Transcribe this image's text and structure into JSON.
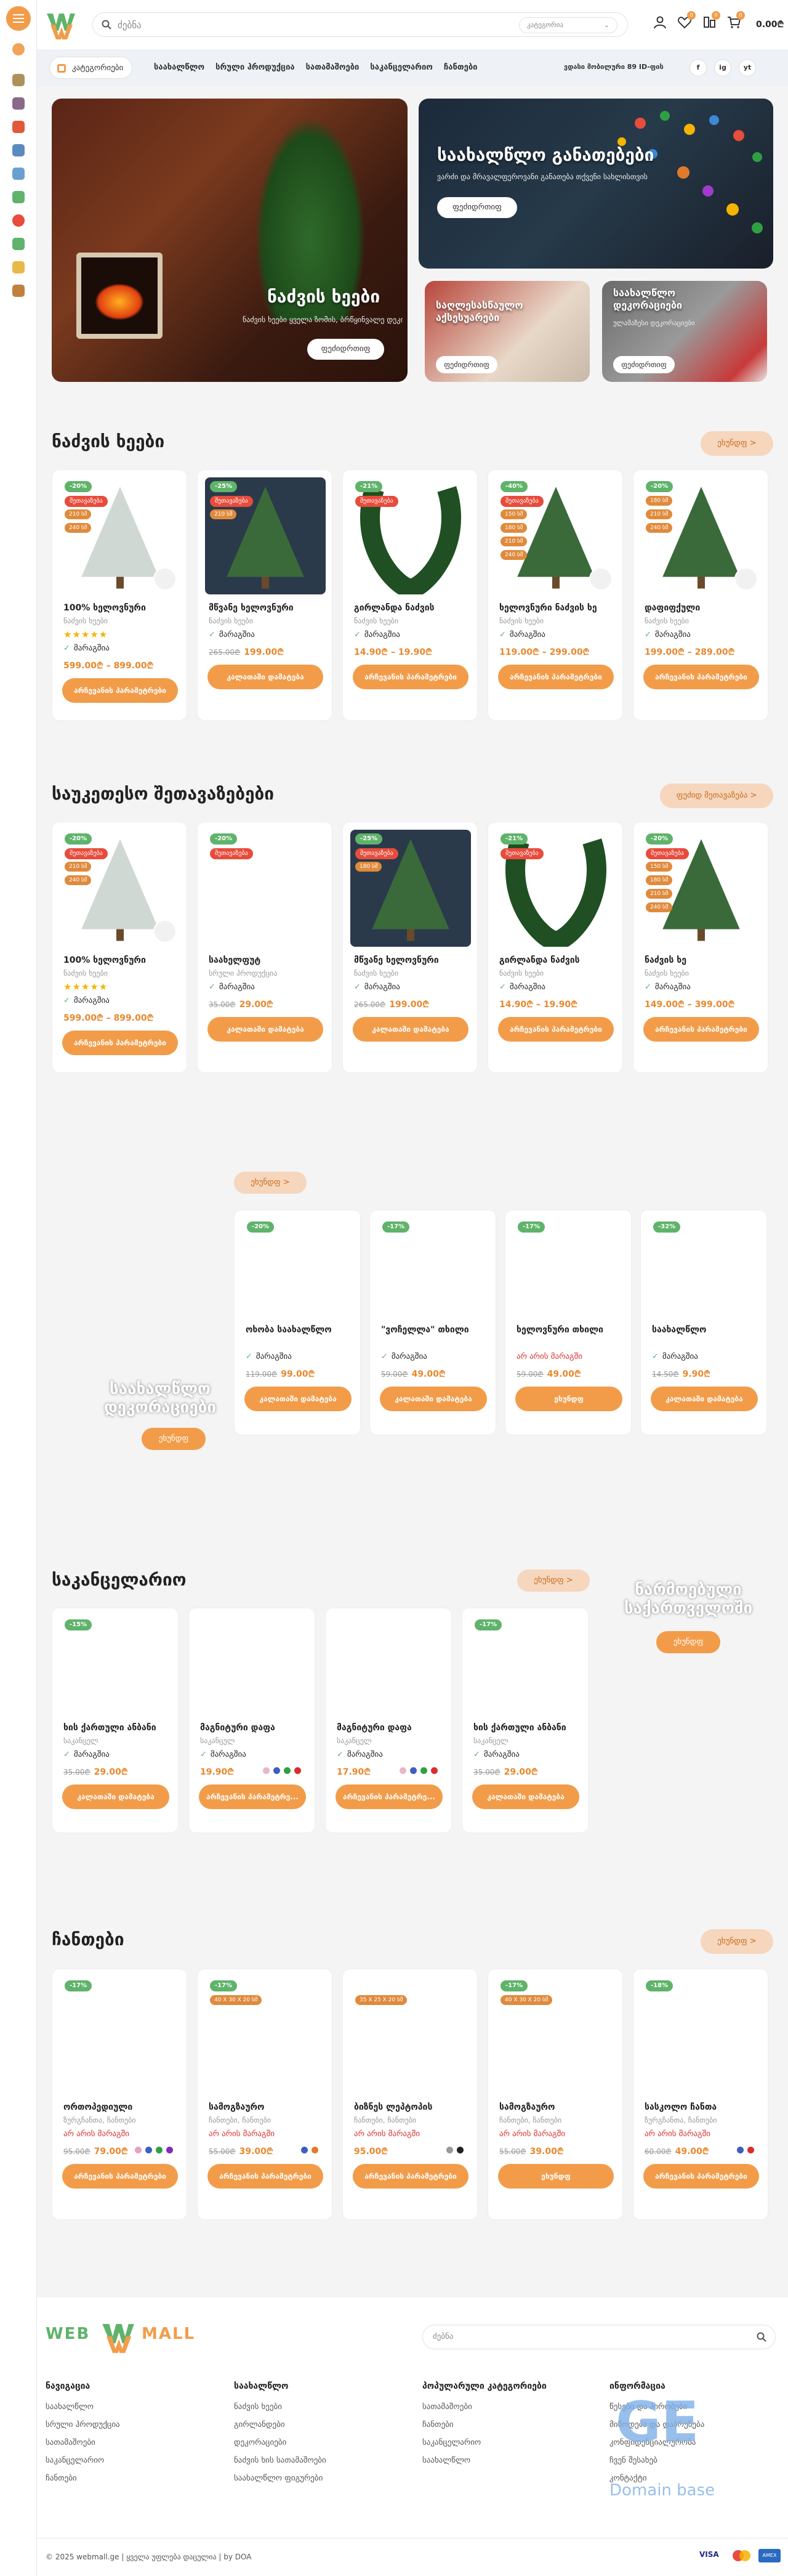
{
  "header": {
    "search_placeholder": "ძებნა",
    "category_select": "კატეგორია",
    "cart_total": "0.00₾",
    "wishlist_count": "0",
    "compare_count": "0",
    "cart_count": "0"
  },
  "nav": {
    "categories_button": "კატეგორიები",
    "links": [
      "საახალწლო",
      "სრული ჰროდუქცია",
      "სათამაშოები",
      "საკანცელარიო",
      "ჩანთები"
    ],
    "phone": "ვდასი მობილური 89 ID-ფის"
  },
  "social": [
    "f",
    "ig",
    "yt"
  ],
  "hero": {
    "main": {
      "title": "ნაძვის ხეები",
      "subtitle": "ნაძვის ხეები ყველა ზომის, ბრწყინვალე დეკორი",
      "button": "ფეძიდრთიფ"
    },
    "top_right": {
      "title": "საახალწლო განათებები",
      "subtitle": "ვარძი და მრავალფეროვანი განათება თქვენი სახლისთვის",
      "button": "ფეძიდრთიფ"
    },
    "bottom_left": {
      "title": "საღლესასწაულო აქსესუარები",
      "button": "ფეძიდრთიფ"
    },
    "bottom_right": {
      "title": "საახალწლო დეკორაციები",
      "subtitle": "ულამაზესი დეკორაციები",
      "button": "ფეძიდრთიფ"
    }
  },
  "sections": {
    "trees": {
      "title": "ნაძვის ხეები",
      "button": "ეხუნდფ >"
    },
    "best": {
      "title": "საუკეთესო შეთავაზებები",
      "button": "ფეძიდ მეთავაზება >"
    },
    "holiday": {
      "button": "ეხუნდფ >",
      "side_title": "საახალწლო დეკორაციები",
      "side_button": "ეხუნდფ"
    },
    "stationery": {
      "title": "საკანცელარიო",
      "button": "ეხუნდფ >",
      "side_title": "ნარმოებული საქართველოში",
      "side_button": "ეხუნდფ"
    },
    "bags": {
      "title": "ჩანთები",
      "button": "ეხუნდფ >"
    }
  },
  "trees_products": [
    {
      "discount": "-20%",
      "tags": [
        "შეთავაზება",
        "210 სმ",
        "240 სმ"
      ],
      "name": "100% ხელოვნური",
      "cat": "ნაძვის ხეები",
      "stock": "მარაგშია",
      "stars": "★★★★★",
      "price": "599.00₾ – 899.00₾",
      "old": "",
      "cta": "არჩევანის პარამეტრები"
    },
    {
      "discount": "-25%",
      "tags": [
        "შეთავაზება",
        "210 სმ"
      ],
      "name": "მწვანე ხელოვნური",
      "cat": "ნაძვის ხეები",
      "stock": "მარაგშია",
      "stars": "",
      "price": "199.00₾",
      "old": "265.00₾",
      "cta": "კალათაში დამატება"
    },
    {
      "discount": "-21%",
      "tags": [
        "შეთავაზება"
      ],
      "name": "გირლანდა ნაძვის",
      "cat": "ნაძვის ხეები",
      "stock": "მარაგშია",
      "stars": "",
      "price": "14.90₾ – 19.90₾",
      "old": "",
      "cta": "არჩევანის პარამეტრები"
    },
    {
      "discount": "-40%",
      "tags": [
        "შეთავაზება",
        "150 სმ",
        "180 სმ",
        "210 სმ",
        "240 სმ"
      ],
      "name": "ხელოვნური ნაძვის ხე",
      "cat": "ნაძვის ხეები",
      "stock": "მარაგშია",
      "stars": "",
      "price": "119.00₾ – 299.00₾",
      "old": "",
      "cta": "არჩევანის პარამეტრები"
    },
    {
      "discount": "-20%",
      "tags": [
        "180 სმ",
        "210 სმ",
        "240 სმ"
      ],
      "name": "დაფიფქული",
      "cat": "ნაძვის ხეები",
      "stock": "მარაგშია",
      "stars": "",
      "price": "199.00₾ – 289.00₾",
      "old": "",
      "cta": "არჩევანის პარამეტრები"
    }
  ],
  "best_products": [
    {
      "discount": "-20%",
      "tags": [
        "შეთავაზება",
        "210 სმ",
        "240 სმ"
      ],
      "name": "100% ხელოვნური",
      "cat": "ნაძვის ხეები",
      "stock": "მარაგშია",
      "stars": "★★★★★",
      "price": "599.00₾ – 899.00₾",
      "old": "",
      "cta": "არჩევანის პარამეტრები"
    },
    {
      "discount": "-20%",
      "tags": [
        "შეთავაზება"
      ],
      "name": "საახელფუტ",
      "cat": "სრული ჰროდუქცია",
      "stock": "მარაგშია",
      "stars": "",
      "price": "29.00₾",
      "old": "35.00₾",
      "cta": "კალათაში დამატება"
    },
    {
      "discount": "-25%",
      "tags": [
        "შეთავაზება",
        "180 სმ"
      ],
      "name": "მწვანე ხელოვნური",
      "cat": "ნაძვის ხეები",
      "stock": "მარაგშია",
      "stars": "",
      "price": "199.00₾",
      "old": "265.00₾",
      "cta": "კალათაში დამატება"
    },
    {
      "discount": "-21%",
      "tags": [
        "შეთავაზება"
      ],
      "name": "გირლანდა ნაძვის",
      "cat": "ნაძვის ხეები",
      "stock": "მარაგშია",
      "stars": "",
      "price": "14.90₾ – 19.90₾",
      "old": "",
      "cta": "არჩევანის პარამეტრები"
    },
    {
      "discount": "-20%",
      "tags": [
        "შეთავაზება",
        "150 სმ",
        "180 სმ",
        "210 სმ",
        "240 სმ"
      ],
      "name": "ნაძვის ხე",
      "cat": "ნაძვის ხეები",
      "stock": "მარაგშია",
      "stars": "",
      "price": "149.00₾ – 399.00₾",
      "old": "",
      "cta": "არჩევანის პარამეტრები"
    }
  ],
  "holiday_products": [
    {
      "discount": "-20%",
      "name": "ოხობა საახალწლო",
      "cat": "",
      "stock": "მარაგშია",
      "price": "99.00₾",
      "old": "119.00₾",
      "cta": "კალათაში დამატება",
      "red": false
    },
    {
      "discount": "-17%",
      "name": "\"ვოჩელლა\" თხილი",
      "cat": "",
      "stock": "მარაგშია",
      "price": "49.00₾",
      "old": "59.00₾",
      "cta": "კალათაში დამატება",
      "red": false
    },
    {
      "discount": "-17%",
      "name": "ხელოვნური თხილი",
      "cat": "",
      "stock": "არ არის მარაგში",
      "price": "49.00₾",
      "old": "59.00₾",
      "cta": "ეხუნდფ",
      "red": true
    },
    {
      "discount": "-32%",
      "name": "საახალწლო",
      "cat": "",
      "stock": "მარაგშია",
      "price": "9.90₾",
      "old": "14.50₾",
      "cta": "კალათაში დამატება",
      "red": false
    }
  ],
  "stationery_products": [
    {
      "discount": "-15%",
      "name": "ხის ქართული ანბანი",
      "cat": "საკანცელ",
      "stock": "მარაგშია",
      "price": "29.00₾",
      "old": "35.00₾",
      "cta": "კალათაში დამატება",
      "dots": []
    },
    {
      "discount": "",
      "name": "მაგნიტური დაფა",
      "cat": "საკანცელ",
      "stock": "მარაგშია",
      "price": "19.90₾",
      "old": "",
      "cta": "არჩევანის პარამეტრე...",
      "dots": [
        "#e6b8c8",
        "#3b5fc0",
        "#2ea043",
        "#d92d2d"
      ]
    },
    {
      "discount": "",
      "name": "მაგნიტური დაფა",
      "cat": "საკანცელ",
      "stock": "მარაგშია",
      "price": "17.90₾",
      "old": "",
      "cta": "არჩევანის პარამეტრე...",
      "dots": [
        "#e6b8c8",
        "#3b5fc0",
        "#2ea043",
        "#d92d2d"
      ]
    },
    {
      "discount": "-17%",
      "name": "ხის ქართული ანბანი",
      "cat": "საკანცელ",
      "stock": "მარაგშია",
      "price": "29.00₾",
      "old": "35.00₾",
      "cta": "კალათაში დამატება",
      "dots": []
    }
  ],
  "bags_products": [
    {
      "discount": "-17%",
      "size": "",
      "name": "ორთოპედიული",
      "cat": "ზურგჩანთა, ჩანთები",
      "stock": "არ არის მარაგში",
      "price": "79.00₾",
      "old": "95.00₾",
      "cta": "არჩევანის პარამეტრები",
      "dots": [
        "#e6a0c0",
        "#3b5fc0",
        "#2ea043",
        "#7b2cbf"
      ]
    },
    {
      "discount": "-17%",
      "size": "40 X 30 X 20 სმ",
      "name": "სამოგზაურო",
      "cat": "ჩანთები, ჩანთები",
      "stock": "არ არის მარაგში",
      "price": "39.00₾",
      "old": "55.00₾",
      "cta": "არჩევანის პარამეტრები",
      "dots": [
        "#3b5fc0",
        "#e07b2a"
      ]
    },
    {
      "discount": "",
      "size": "35 X 25 X 20 სმ",
      "name": "ბიზნეს ლეპტოპის",
      "cat": "ჩანთები, ჩანთები",
      "stock": "არ არის მარაგში",
      "price": "95.00₾",
      "old": "",
      "cta": "არჩევანის პარამეტრები",
      "dots": [
        "#999",
        "#222"
      ]
    },
    {
      "discount": "-17%",
      "size": "40 X 30 X 20 სმ",
      "name": "სამოგზაურო",
      "cat": "ჩანთები, ჩანთები",
      "stock": "არ არის მარაგში",
      "price": "39.00₾",
      "old": "55.00₾",
      "cta": "ეხუნდფ",
      "dots": []
    },
    {
      "discount": "-18%",
      "size": "",
      "name": "სასკოლო ჩანთა",
      "cat": "ზურგჩანთა, ჩანთები",
      "stock": "არ არის მარაგში",
      "price": "49.00₾",
      "old": "60.00₾",
      "cta": "არჩევანის პარამეტრები",
      "dots": [
        "#3b5fc0",
        "#d92d2d"
      ]
    }
  ],
  "footer": {
    "search_placeholder": "ძებნა",
    "cols": [
      {
        "title": "ნავიგაცია",
        "items": [
          "საახალწლო",
          "სრული ჰროდუქცია",
          "სათამაშოები",
          "საკანცელარიო",
          "ჩანთები"
        ]
      },
      {
        "title": "საახალწლო",
        "items": [
          "ნაძვის ხეები",
          "გირლანდები",
          "დეკორაციები",
          "ნაძვის ხის სათამაშოები",
          "საახალწლო ფიგურები"
        ]
      },
      {
        "title": "პოპულარული კატეგორიები",
        "items": [
          "სათამაშოები",
          "ჩანთები",
          "საკანცელარიო",
          "საახალწლო"
        ]
      },
      {
        "title": "ინფორმაცია",
        "items": [
          "წესები და პირობები",
          "მიწოდება და დაბრუნება",
          "კონფიდენციალურობა",
          "ჩვენ შესახებ",
          "კონტაქტი"
        ]
      }
    ],
    "copyright": "© 2025 webmall.ge | ყველა უფლება დაცულია | by DOA",
    "payments": [
      "VISA",
      "MC",
      "AMEX"
    ],
    "logo_left": "WEB",
    "logo_right": "MALL",
    "watermark_big": "GE",
    "watermark_small": "Domain base"
  },
  "colors": {
    "accent": "#f29c4a",
    "green": "#5fb36a",
    "red": "#e74c3c"
  }
}
